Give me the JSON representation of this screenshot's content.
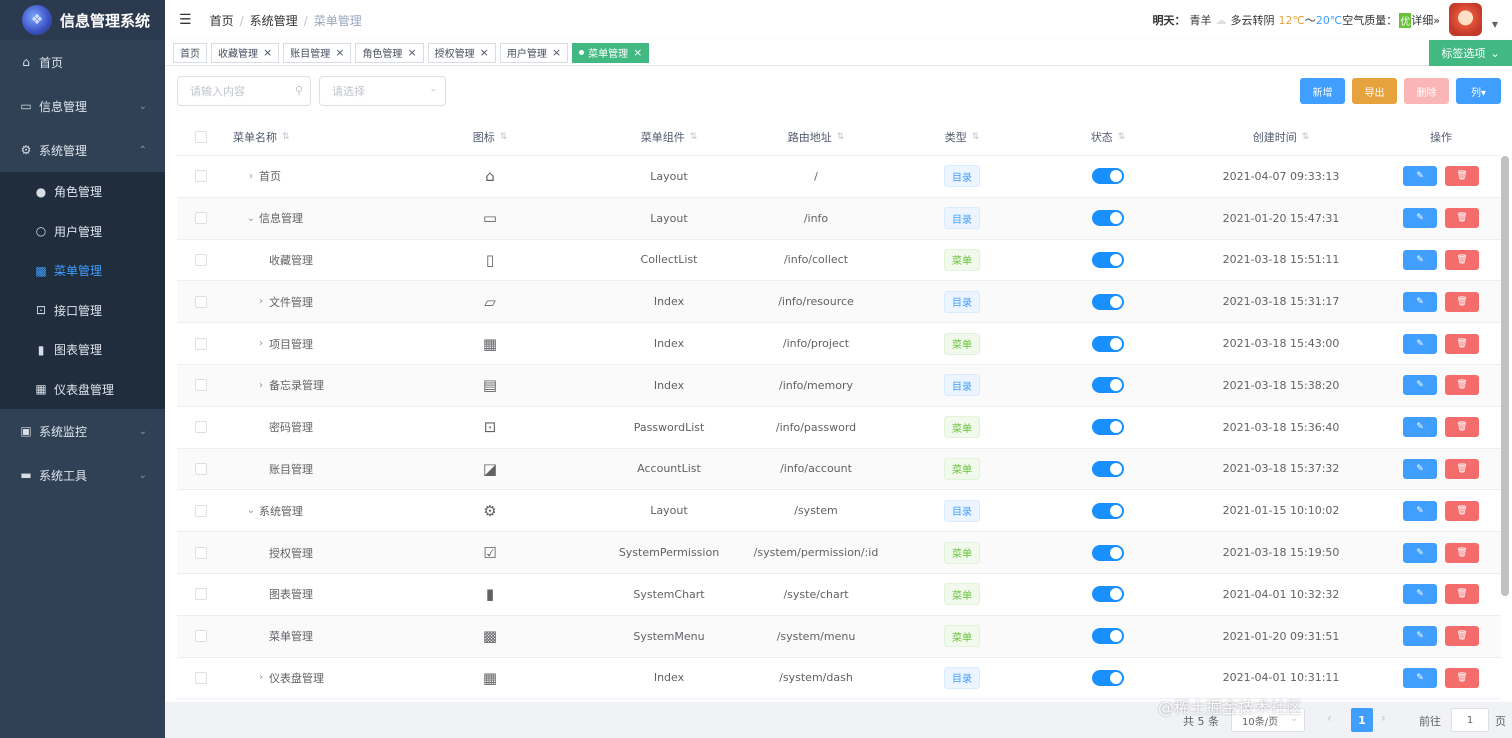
{
  "app": {
    "title": "信息管理系统"
  },
  "sidebar": {
    "items": [
      {
        "label": "首页",
        "icon": "home-icon"
      },
      {
        "label": "信息管理",
        "icon": "archive-icon"
      },
      {
        "label": "系统管理",
        "icon": "gear-icon"
      },
      {
        "label": "系统监控",
        "icon": "monitor-icon"
      },
      {
        "label": "系统工具",
        "icon": "toolbox-icon"
      }
    ],
    "sub_items": [
      {
        "label": "角色管理",
        "icon": "user-icon"
      },
      {
        "label": "用户管理",
        "icon": "user-outline-icon"
      },
      {
        "label": "菜单管理",
        "icon": "grid-icon"
      },
      {
        "label": "接口管理",
        "icon": "lock-icon"
      },
      {
        "label": "图表管理",
        "icon": "bar-chart-icon"
      },
      {
        "label": "仪表盘管理",
        "icon": "apps-icon"
      }
    ]
  },
  "header": {
    "breadcrumb": [
      "首页",
      "系统管理",
      "菜单管理"
    ],
    "weather": {
      "day": "明天：",
      "city": "青羊",
      "desc": "多云转阴",
      "low": "12℃",
      "tilde": "～",
      "high": "20℃",
      "aq_label": "空气质量：",
      "aq_value": "优",
      "detail": "详细»"
    }
  },
  "tags": {
    "items": [
      "首页",
      "收藏管理",
      "账目管理",
      "角色管理",
      "授权管理",
      "用户管理",
      "菜单管理"
    ],
    "options_label": "标签选项"
  },
  "toolbar": {
    "search_placeholder": "请输入内容",
    "select_placeholder": "请选择",
    "add_label": "新增",
    "export_label": "导出",
    "delete_label": "删除",
    "columns_label": "列▾"
  },
  "table": {
    "headers": [
      "菜单名称",
      "图标",
      "菜单组件",
      "路由地址",
      "类型",
      "状态",
      "创建时间",
      "操作"
    ],
    "rows": [
      {
        "name": "首页",
        "indent": 0,
        "expand": "›",
        "icon": "home-icon",
        "glyph": "⌂",
        "component": "Layout",
        "path": "/",
        "type": "目录",
        "type_key": "dir",
        "enabled": true,
        "created": "2021-04-07 09:33:13"
      },
      {
        "name": "信息管理",
        "indent": 0,
        "expand": "⌄",
        "icon": "archive-icon",
        "glyph": "▭",
        "component": "Layout",
        "path": "/info",
        "type": "目录",
        "type_key": "dir",
        "enabled": true,
        "created": "2021-01-20 15:47:31"
      },
      {
        "name": "收藏管理",
        "indent": 1,
        "expand": "",
        "icon": "bookmark-icon",
        "glyph": "▯",
        "component": "CollectList",
        "path": "/info/collect",
        "type": "菜单",
        "type_key": "menu",
        "enabled": true,
        "created": "2021-03-18 15:51:11"
      },
      {
        "name": "文件管理",
        "indent": 1,
        "expand": "›",
        "icon": "folder-icon",
        "glyph": "▱",
        "component": "Index",
        "path": "/info/resource",
        "type": "目录",
        "type_key": "dir",
        "enabled": true,
        "created": "2021-03-18 15:31:17"
      },
      {
        "name": "项目管理",
        "indent": 1,
        "expand": "›",
        "icon": "apps-icon",
        "glyph": "▦",
        "component": "Index",
        "path": "/info/project",
        "type": "菜单",
        "type_key": "menu",
        "enabled": true,
        "created": "2021-03-18 15:43:00"
      },
      {
        "name": "备忘录管理",
        "indent": 1,
        "expand": "›",
        "icon": "document-icon",
        "glyph": "▤",
        "component": "Index",
        "path": "/info/memory",
        "type": "目录",
        "type_key": "dir",
        "enabled": true,
        "created": "2021-03-18 15:38:20"
      },
      {
        "name": "密码管理",
        "indent": 1,
        "expand": "",
        "icon": "lock-icon",
        "glyph": "⊡",
        "component": "PasswordList",
        "path": "/info/password",
        "type": "菜单",
        "type_key": "menu",
        "enabled": true,
        "created": "2021-03-18 15:36:40"
      },
      {
        "name": "账目管理",
        "indent": 1,
        "expand": "",
        "icon": "line-chart-icon",
        "glyph": "◪",
        "component": "AccountList",
        "path": "/info/account",
        "type": "菜单",
        "type_key": "menu",
        "enabled": true,
        "created": "2021-03-18 15:37:32"
      },
      {
        "name": "系统管理",
        "indent": 0,
        "expand": "⌄",
        "icon": "gear-icon",
        "glyph": "⚙",
        "component": "Layout",
        "path": "/system",
        "type": "目录",
        "type_key": "dir",
        "enabled": true,
        "created": "2021-01-15 10:10:02"
      },
      {
        "name": "授权管理",
        "indent": 1,
        "expand": "",
        "icon": "doc-check-icon",
        "glyph": "☑",
        "component": "SystemPermission",
        "path": "/system/permission/:id",
        "type": "菜单",
        "type_key": "menu",
        "enabled": true,
        "created": "2021-03-18 15:19:50"
      },
      {
        "name": "图表管理",
        "indent": 1,
        "expand": "",
        "icon": "bar-chart-icon",
        "glyph": "▮",
        "component": "SystemChart",
        "path": "/syste/chart",
        "type": "菜单",
        "type_key": "menu",
        "enabled": true,
        "created": "2021-04-01 10:32:32"
      },
      {
        "name": "菜单管理",
        "indent": 1,
        "expand": "",
        "icon": "grid-icon",
        "glyph": "▩",
        "component": "SystemMenu",
        "path": "/system/menu",
        "type": "菜单",
        "type_key": "menu",
        "enabled": true,
        "created": "2021-01-20 09:31:51"
      },
      {
        "name": "仪表盘管理",
        "indent": 1,
        "expand": "›",
        "icon": "apps-icon",
        "glyph": "▦",
        "component": "Index",
        "path": "/system/dash",
        "type": "目录",
        "type_key": "dir",
        "enabled": true,
        "created": "2021-04-01 10:31:11"
      }
    ],
    "edit_glyph": "✎",
    "delete_glyph": "🗑"
  },
  "pagination": {
    "total": "共 5 条",
    "page_size": "10条/页",
    "current": "1",
    "goto_label": "前往",
    "goto_value": "1",
    "unit": "页"
  },
  "watermark": "@稀土掘金技术社区",
  "colors": {
    "sidebar": "#304156",
    "primary": "#409eff",
    "success": "#42b983",
    "warning": "#e6a23c",
    "danger": "#f56c6c"
  }
}
